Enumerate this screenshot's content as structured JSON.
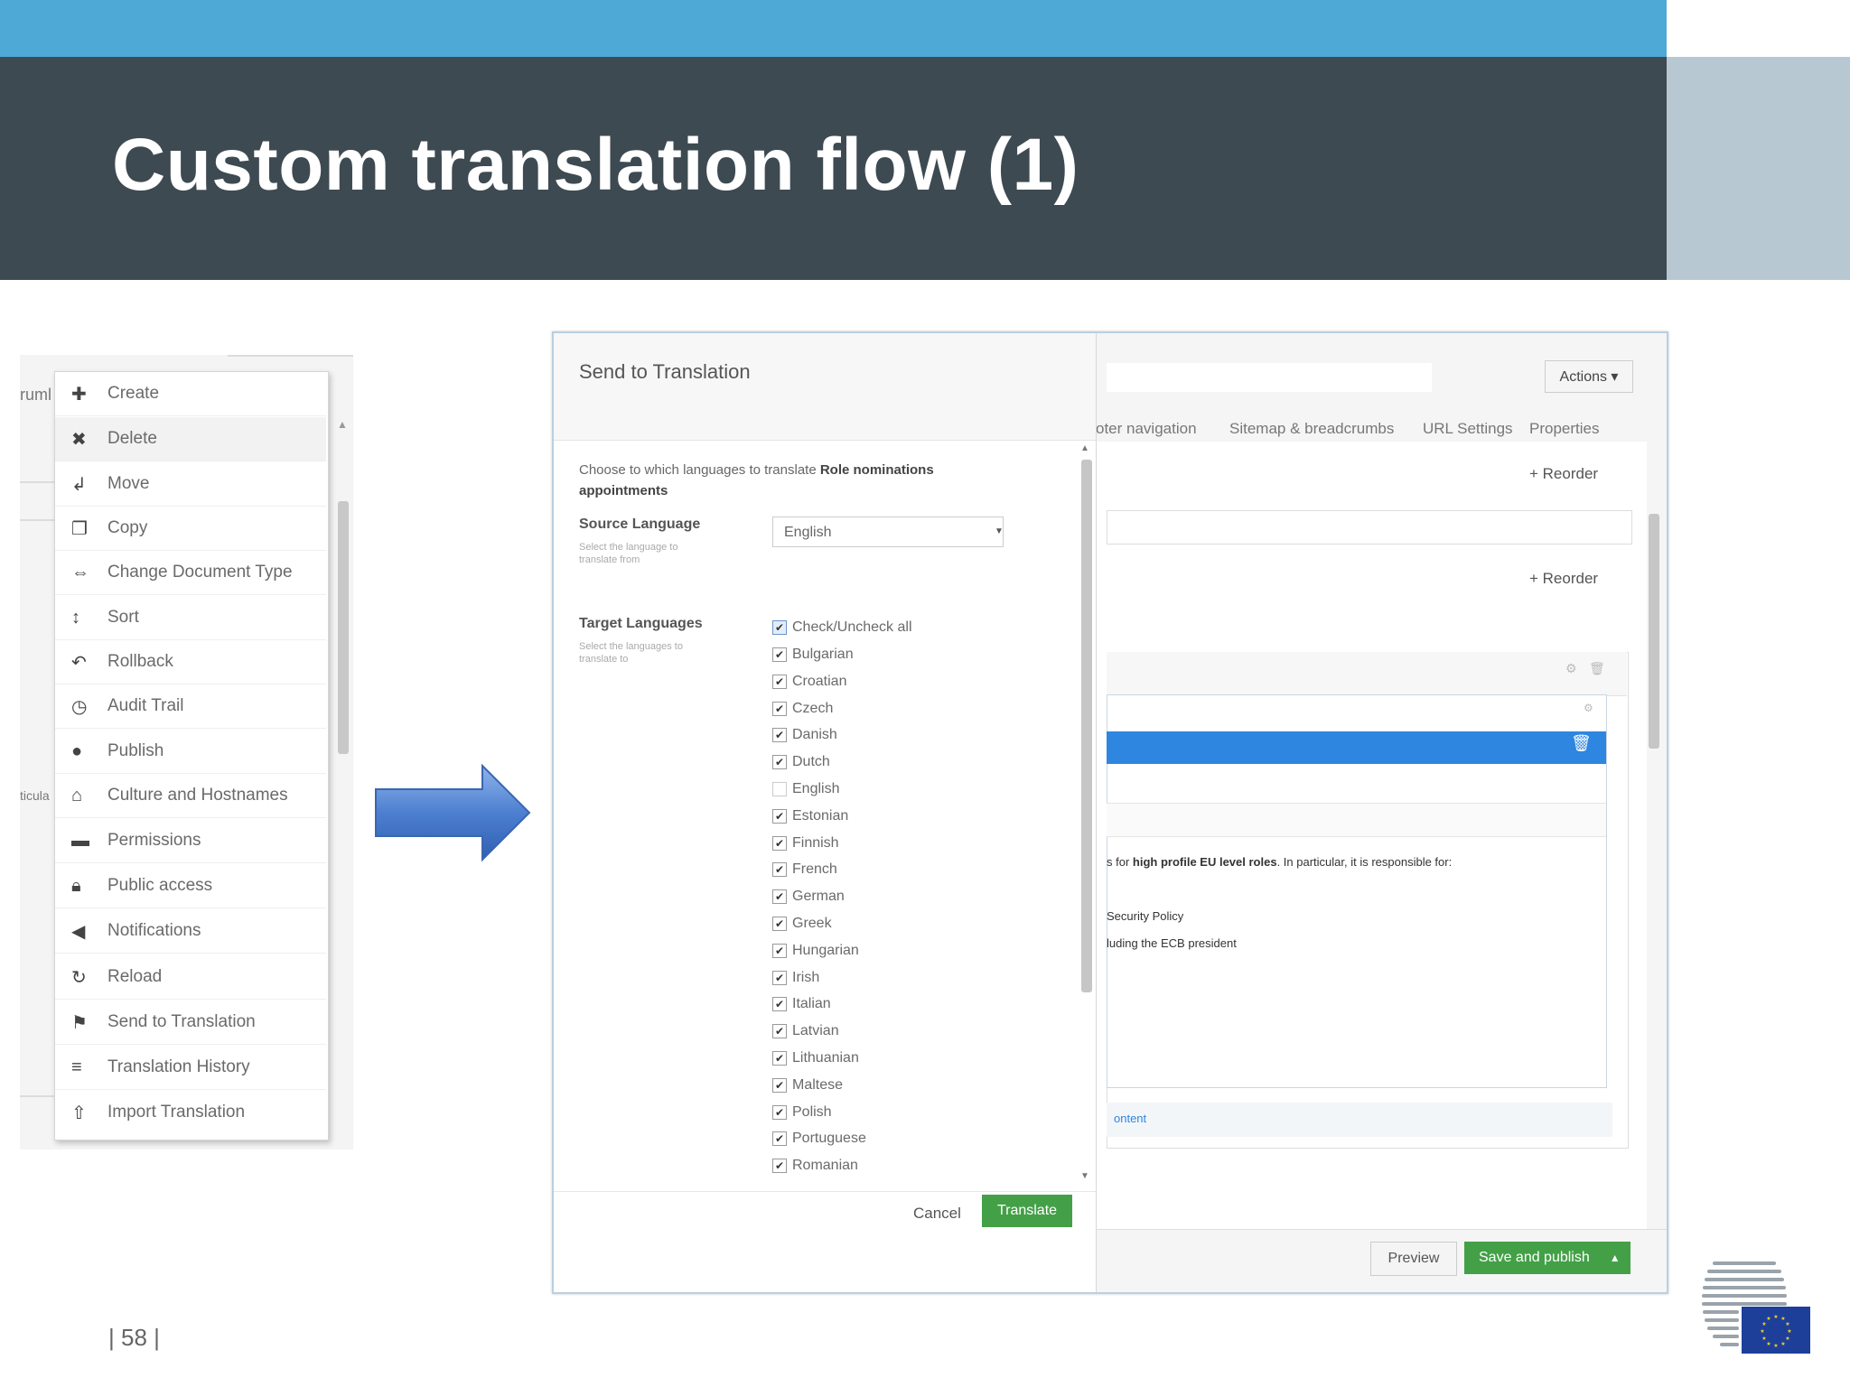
{
  "slide": {
    "title": "Custom translation flow (1)",
    "page_number": "| 58 |"
  },
  "context_menu": {
    "breadcrumb_fragment": "ruml",
    "side_fragment": "ticula",
    "items": [
      {
        "label": "Create",
        "icon": "plus-icon"
      },
      {
        "label": "Delete",
        "icon": "close-icon"
      },
      {
        "label": "Move",
        "icon": "move-icon"
      },
      {
        "label": "Copy",
        "icon": "copy-icon"
      },
      {
        "label": "Change Document Type",
        "icon": "change-type-icon"
      },
      {
        "label": "Sort",
        "icon": "sort-icon"
      },
      {
        "label": "Rollback",
        "icon": "rollback-icon"
      },
      {
        "label": "Audit Trail",
        "icon": "clock-icon"
      },
      {
        "label": "Publish",
        "icon": "globe-icon"
      },
      {
        "label": "Culture and Hostnames",
        "icon": "home-icon"
      },
      {
        "label": "Permissions",
        "icon": "permissions-icon"
      },
      {
        "label": "Public access",
        "icon": "lock-icon"
      },
      {
        "label": "Notifications",
        "icon": "megaphone-icon"
      },
      {
        "label": "Reload",
        "icon": "reload-icon"
      },
      {
        "label": "Send to Translation",
        "icon": "flag-icon"
      },
      {
        "label": "Translation History",
        "icon": "list-icon"
      },
      {
        "label": "Import Translation",
        "icon": "upload-icon"
      }
    ]
  },
  "dialog": {
    "title": "Send to Translation",
    "intro_prefix": "Choose to which languages to translate ",
    "intro_bold": "Role nominations appointments",
    "source": {
      "label": "Source Language",
      "sub": "Select the language to translate from",
      "value": "English"
    },
    "target": {
      "label": "Target Languages",
      "sub": "Select the languages to translate to",
      "check_all": "Check/Uncheck all",
      "languages": [
        {
          "name": "Bulgarian",
          "checked": true
        },
        {
          "name": "Croatian",
          "checked": true
        },
        {
          "name": "Czech",
          "checked": true
        },
        {
          "name": "Danish",
          "checked": true
        },
        {
          "name": "Dutch",
          "checked": true
        },
        {
          "name": "English",
          "checked": false
        },
        {
          "name": "Estonian",
          "checked": true
        },
        {
          "name": "Finnish",
          "checked": true
        },
        {
          "name": "French",
          "checked": true
        },
        {
          "name": "German",
          "checked": true
        },
        {
          "name": "Greek",
          "checked": true
        },
        {
          "name": "Hungarian",
          "checked": true
        },
        {
          "name": "Irish",
          "checked": true
        },
        {
          "name": "Italian",
          "checked": true
        },
        {
          "name": "Latvian",
          "checked": true
        },
        {
          "name": "Lithuanian",
          "checked": true
        },
        {
          "name": "Maltese",
          "checked": true
        },
        {
          "name": "Polish",
          "checked": true
        },
        {
          "name": "Portuguese",
          "checked": true
        },
        {
          "name": "Romanian",
          "checked": true
        }
      ]
    },
    "cancel": "Cancel",
    "translate": "Translate"
  },
  "background_editor": {
    "actions": "Actions ▾",
    "tabs": [
      "oter navigation",
      "Sitemap & breadcrumbs",
      "URL Settings",
      "Properties"
    ],
    "reorder": "+ Reorder",
    "body_line1_prefix": "s for ",
    "body_line1_bold": "high profile EU level roles",
    "body_line1_suffix": ". In particular, it is responsible for:",
    "body_line2": "Security Policy",
    "body_line3": "luding the ECB president",
    "content_link": "ontent",
    "preview": "Preview",
    "save_publish": "Save and publish"
  },
  "colors": {
    "header_blue": "#4fa9d6",
    "header_dark": "#3e4a52",
    "accent_green": "#43a047",
    "selection_blue": "#2f86e0"
  }
}
